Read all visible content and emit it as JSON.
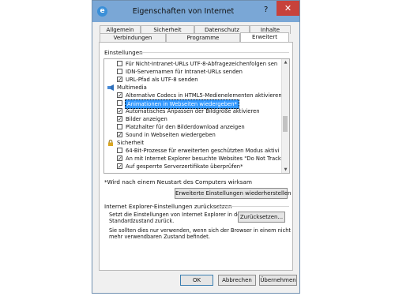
{
  "window": {
    "title": "Eigenschaften von Internet",
    "help_glyph": "?",
    "close_glyph": "✕"
  },
  "tabs_back": [
    "Allgemein",
    "Sicherheit",
    "Datenschutz",
    "Inhalte"
  ],
  "tabs_front": [
    "Verbindungen",
    "Programme",
    "Erweitert"
  ],
  "settings_label": "Einstellungen",
  "tree_items": [
    {
      "type": "cb",
      "checked": false,
      "text": "Für Nicht-Intranet-URLs UTF-8-Abfragezeichenfolgen sen"
    },
    {
      "type": "cb",
      "checked": false,
      "text": "IDN-Servernamen für Intranet-URLs senden"
    },
    {
      "type": "cb",
      "checked": true,
      "text": "URL-Pfad als UTF-8 senden"
    },
    {
      "type": "cat",
      "icon": "multimedia-icon",
      "text": "Multimedia"
    },
    {
      "type": "cb",
      "checked": true,
      "text": "Alternative Codecs in HTML5-Medienelementen aktivieren"
    },
    {
      "type": "cb",
      "checked": false,
      "text": "Animationen in Webseiten wiedergeben*",
      "selected": true
    },
    {
      "type": "cb",
      "checked": true,
      "text": "Automatisches Anpassen der Bildgröße aktivieren"
    },
    {
      "type": "cb",
      "checked": true,
      "text": "Bilder anzeigen"
    },
    {
      "type": "cb",
      "checked": false,
      "text": "Platzhalter für den Bilderdownload anzeigen"
    },
    {
      "type": "cb",
      "checked": true,
      "text": "Sound in Webseiten wiedergeben"
    },
    {
      "type": "cat",
      "icon": "lock-icon",
      "text": "Sicherheit"
    },
    {
      "type": "cb",
      "checked": false,
      "text": "64-Bit-Prozesse für erweiterten geschützten Modus aktivi"
    },
    {
      "type": "cb",
      "checked": true,
      "text": "An mit Internet Explorer besuchte Websites \"Do Not Track"
    },
    {
      "type": "cb",
      "checked": true,
      "text": "Auf gesperrte Serverzertifikate überprüfen*"
    }
  ],
  "check_glyph": "✓",
  "restart_note": "*Wird nach einem Neustart des Computers wirksam",
  "restore_advanced_button": "Erweiterte Einstellungen wiederherstellen",
  "reset_section": {
    "title": "Internet Explorer-Einstellungen zurücksetzen",
    "line1": "Setzt die Einstellungen von Internet Explorer in den",
    "line2": "Standardzustand zurück.",
    "reset_button": "Zurücksetzen...",
    "warn1": "Sie sollten dies nur verwenden, wenn sich der Browser in einem nicht",
    "warn2": "mehr verwendbaren Zustand befindet."
  },
  "footer": {
    "ok": "OK",
    "cancel": "Abbrechen",
    "apply": "Übernehmen"
  },
  "colors": {
    "titlebar": "#7aa7d6",
    "close": "#c7423b",
    "selection": "#3399ff"
  }
}
